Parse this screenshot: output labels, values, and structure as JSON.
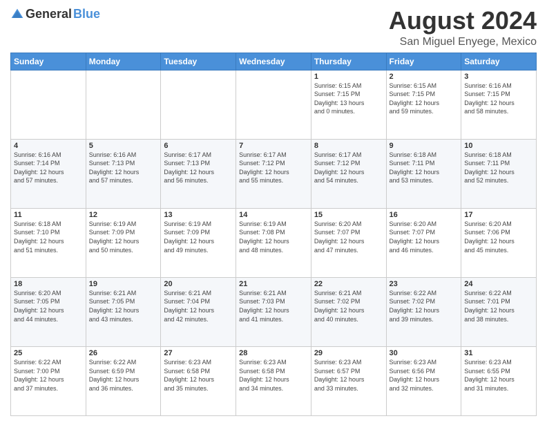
{
  "logo": {
    "general": "General",
    "blue": "Blue"
  },
  "header": {
    "title": "August 2024",
    "subtitle": "San Miguel Enyege, Mexico"
  },
  "weekdays": [
    "Sunday",
    "Monday",
    "Tuesday",
    "Wednesday",
    "Thursday",
    "Friday",
    "Saturday"
  ],
  "weeks": [
    [
      {
        "day": "",
        "info": ""
      },
      {
        "day": "",
        "info": ""
      },
      {
        "day": "",
        "info": ""
      },
      {
        "day": "",
        "info": ""
      },
      {
        "day": "1",
        "info": "Sunrise: 6:15 AM\nSunset: 7:15 PM\nDaylight: 13 hours\nand 0 minutes."
      },
      {
        "day": "2",
        "info": "Sunrise: 6:15 AM\nSunset: 7:15 PM\nDaylight: 12 hours\nand 59 minutes."
      },
      {
        "day": "3",
        "info": "Sunrise: 6:16 AM\nSunset: 7:15 PM\nDaylight: 12 hours\nand 58 minutes."
      }
    ],
    [
      {
        "day": "4",
        "info": "Sunrise: 6:16 AM\nSunset: 7:14 PM\nDaylight: 12 hours\nand 57 minutes."
      },
      {
        "day": "5",
        "info": "Sunrise: 6:16 AM\nSunset: 7:13 PM\nDaylight: 12 hours\nand 57 minutes."
      },
      {
        "day": "6",
        "info": "Sunrise: 6:17 AM\nSunset: 7:13 PM\nDaylight: 12 hours\nand 56 minutes."
      },
      {
        "day": "7",
        "info": "Sunrise: 6:17 AM\nSunset: 7:12 PM\nDaylight: 12 hours\nand 55 minutes."
      },
      {
        "day": "8",
        "info": "Sunrise: 6:17 AM\nSunset: 7:12 PM\nDaylight: 12 hours\nand 54 minutes."
      },
      {
        "day": "9",
        "info": "Sunrise: 6:18 AM\nSunset: 7:11 PM\nDaylight: 12 hours\nand 53 minutes."
      },
      {
        "day": "10",
        "info": "Sunrise: 6:18 AM\nSunset: 7:11 PM\nDaylight: 12 hours\nand 52 minutes."
      }
    ],
    [
      {
        "day": "11",
        "info": "Sunrise: 6:18 AM\nSunset: 7:10 PM\nDaylight: 12 hours\nand 51 minutes."
      },
      {
        "day": "12",
        "info": "Sunrise: 6:19 AM\nSunset: 7:09 PM\nDaylight: 12 hours\nand 50 minutes."
      },
      {
        "day": "13",
        "info": "Sunrise: 6:19 AM\nSunset: 7:09 PM\nDaylight: 12 hours\nand 49 minutes."
      },
      {
        "day": "14",
        "info": "Sunrise: 6:19 AM\nSunset: 7:08 PM\nDaylight: 12 hours\nand 48 minutes."
      },
      {
        "day": "15",
        "info": "Sunrise: 6:20 AM\nSunset: 7:07 PM\nDaylight: 12 hours\nand 47 minutes."
      },
      {
        "day": "16",
        "info": "Sunrise: 6:20 AM\nSunset: 7:07 PM\nDaylight: 12 hours\nand 46 minutes."
      },
      {
        "day": "17",
        "info": "Sunrise: 6:20 AM\nSunset: 7:06 PM\nDaylight: 12 hours\nand 45 minutes."
      }
    ],
    [
      {
        "day": "18",
        "info": "Sunrise: 6:20 AM\nSunset: 7:05 PM\nDaylight: 12 hours\nand 44 minutes."
      },
      {
        "day": "19",
        "info": "Sunrise: 6:21 AM\nSunset: 7:05 PM\nDaylight: 12 hours\nand 43 minutes."
      },
      {
        "day": "20",
        "info": "Sunrise: 6:21 AM\nSunset: 7:04 PM\nDaylight: 12 hours\nand 42 minutes."
      },
      {
        "day": "21",
        "info": "Sunrise: 6:21 AM\nSunset: 7:03 PM\nDaylight: 12 hours\nand 41 minutes."
      },
      {
        "day": "22",
        "info": "Sunrise: 6:21 AM\nSunset: 7:02 PM\nDaylight: 12 hours\nand 40 minutes."
      },
      {
        "day": "23",
        "info": "Sunrise: 6:22 AM\nSunset: 7:02 PM\nDaylight: 12 hours\nand 39 minutes."
      },
      {
        "day": "24",
        "info": "Sunrise: 6:22 AM\nSunset: 7:01 PM\nDaylight: 12 hours\nand 38 minutes."
      }
    ],
    [
      {
        "day": "25",
        "info": "Sunrise: 6:22 AM\nSunset: 7:00 PM\nDaylight: 12 hours\nand 37 minutes."
      },
      {
        "day": "26",
        "info": "Sunrise: 6:22 AM\nSunset: 6:59 PM\nDaylight: 12 hours\nand 36 minutes."
      },
      {
        "day": "27",
        "info": "Sunrise: 6:23 AM\nSunset: 6:58 PM\nDaylight: 12 hours\nand 35 minutes."
      },
      {
        "day": "28",
        "info": "Sunrise: 6:23 AM\nSunset: 6:58 PM\nDaylight: 12 hours\nand 34 minutes."
      },
      {
        "day": "29",
        "info": "Sunrise: 6:23 AM\nSunset: 6:57 PM\nDaylight: 12 hours\nand 33 minutes."
      },
      {
        "day": "30",
        "info": "Sunrise: 6:23 AM\nSunset: 6:56 PM\nDaylight: 12 hours\nand 32 minutes."
      },
      {
        "day": "31",
        "info": "Sunrise: 6:23 AM\nSunset: 6:55 PM\nDaylight: 12 hours\nand 31 minutes."
      }
    ]
  ]
}
